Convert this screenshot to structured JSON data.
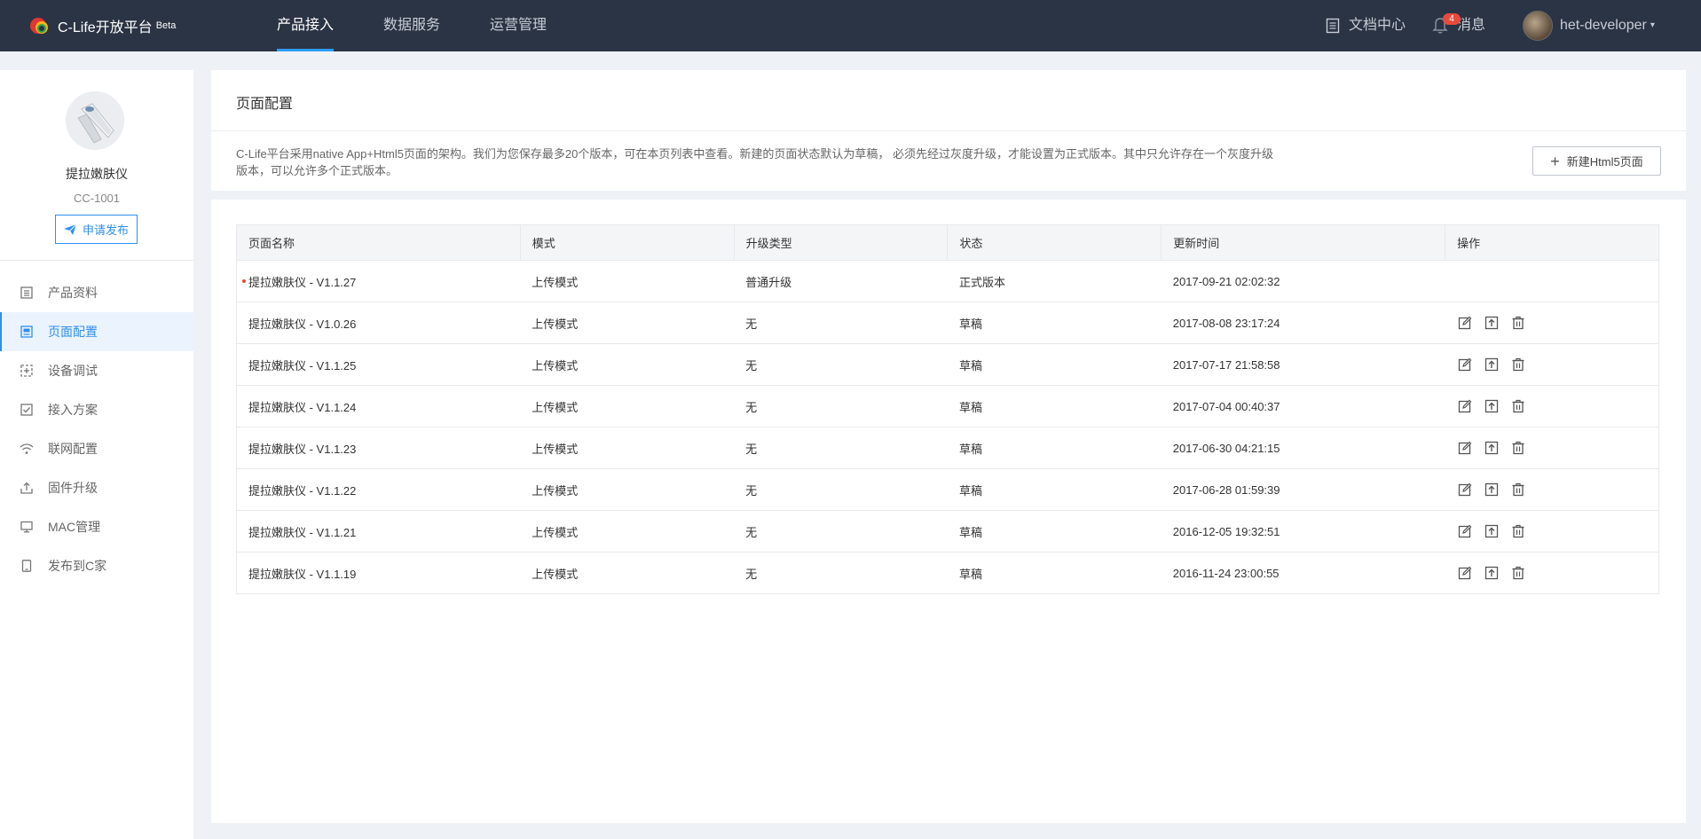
{
  "app": {
    "title": "C-Life开放平台",
    "beta": "Beta",
    "colors": {
      "nav_bg": "#2b3444",
      "accent": "#2e8ff0",
      "badge": "#e64b3b"
    }
  },
  "nav": {
    "tabs": [
      {
        "label": "产品接入",
        "active": true
      },
      {
        "label": "数据服务",
        "active": false
      },
      {
        "label": "运营管理",
        "active": false
      }
    ],
    "docs": "文档中心",
    "messages": "消息",
    "message_count": "4",
    "user": "het-developer"
  },
  "product": {
    "name": "提拉嫩肤仪",
    "code": "CC-1001",
    "apply_label": "申请发布"
  },
  "sidebar": {
    "items": [
      {
        "label": "产品资料",
        "icon": "document-icon",
        "active": false
      },
      {
        "label": "页面配置",
        "icon": "page-config-icon",
        "active": true
      },
      {
        "label": "设备调试",
        "icon": "debug-icon",
        "active": false
      },
      {
        "label": "接入方案",
        "icon": "scheme-icon",
        "active": false
      },
      {
        "label": "联网配置",
        "icon": "wifi-icon",
        "active": false
      },
      {
        "label": "固件升级",
        "icon": "upload-icon",
        "active": false
      },
      {
        "label": "MAC管理",
        "icon": "monitor-icon",
        "active": false
      },
      {
        "label": "发布到C家",
        "icon": "phone-icon",
        "active": false
      }
    ]
  },
  "page": {
    "title": "页面配置",
    "description": "C-Life平台采用native App+Html5页面的架构。我们为您保存最多20个版本，可在本页列表中查看。新建的页面状态默认为草稿， 必须先经过灰度升级，才能设置为正式版本。其中只允许存在一个灰度升级版本，可以允许多个正式版本。",
    "new_button": "新建Html5页面"
  },
  "table": {
    "headers": [
      "页面名称",
      "模式",
      "升级类型",
      "状态",
      "更新时间",
      "操作"
    ],
    "rows": [
      {
        "name": "提拉嫩肤仪 - V1.1.27",
        "mode": "上传模式",
        "upgrade": "普通升级",
        "status": "正式版本",
        "time": "2017-09-21 02:02:32",
        "has_actions": false,
        "marked": true
      },
      {
        "name": "提拉嫩肤仪 - V1.0.26",
        "mode": "上传模式",
        "upgrade": "无",
        "status": "草稿",
        "time": "2017-08-08 23:17:24",
        "has_actions": true,
        "marked": false
      },
      {
        "name": "提拉嫩肤仪 - V1.1.25",
        "mode": "上传模式",
        "upgrade": "无",
        "status": "草稿",
        "time": "2017-07-17 21:58:58",
        "has_actions": true,
        "marked": false
      },
      {
        "name": "提拉嫩肤仪 - V1.1.24",
        "mode": "上传模式",
        "upgrade": "无",
        "status": "草稿",
        "time": "2017-07-04 00:40:37",
        "has_actions": true,
        "marked": false
      },
      {
        "name": "提拉嫩肤仪 - V1.1.23",
        "mode": "上传模式",
        "upgrade": "无",
        "status": "草稿",
        "time": "2017-06-30 04:21:15",
        "has_actions": true,
        "marked": false
      },
      {
        "name": "提拉嫩肤仪 - V1.1.22",
        "mode": "上传模式",
        "upgrade": "无",
        "status": "草稿",
        "time": "2017-06-28 01:59:39",
        "has_actions": true,
        "marked": false
      },
      {
        "name": "提拉嫩肤仪 - V1.1.21",
        "mode": "上传模式",
        "upgrade": "无",
        "status": "草稿",
        "time": "2016-12-05 19:32:51",
        "has_actions": true,
        "marked": false
      },
      {
        "name": "提拉嫩肤仪 - V1.1.19",
        "mode": "上传模式",
        "upgrade": "无",
        "status": "草稿",
        "time": "2016-11-24 23:00:55",
        "has_actions": true,
        "marked": false
      }
    ]
  }
}
